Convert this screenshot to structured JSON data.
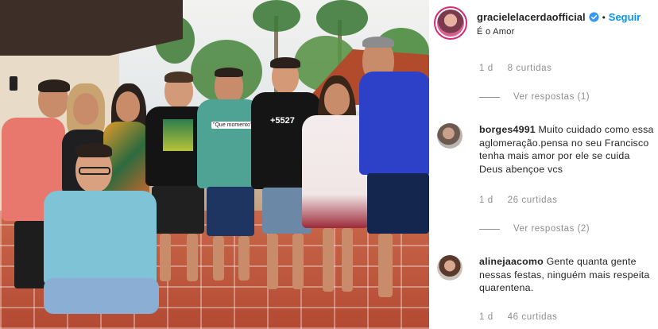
{
  "post": {
    "author": "gracielelacerdaofficial",
    "separator": "•",
    "follow_label": "Seguir",
    "caption": "É o Amor",
    "caption_age": "1 d",
    "caption_likes": "8 curtidas",
    "photo_shirt_texts": [
      "\"Que momento\"",
      "+5527"
    ]
  },
  "comments": [
    {
      "username": "",
      "text": "",
      "age": "",
      "likes": "",
      "replies_label": "Ver respostas (1)"
    },
    {
      "username": "borges4991",
      "text": "Muito cuidado como essa aglomeração.pensa no seu Francisco tenha mais amor por ele se cuida Deus abençoe vcs",
      "age": "1 d",
      "likes": "26 curtidas",
      "replies_label": "Ver respostas (2)"
    },
    {
      "username": "alinejaacomo",
      "text": "Gente quanta gente nessas festas, ninguém mais respeita quarentena.",
      "age": "1 d",
      "likes": "46 curtidas",
      "replies_label": ""
    }
  ],
  "icons": {
    "verified": "verified-badge-icon",
    "replies_line": "thread-line"
  },
  "colors": {
    "follow": "#0095f6",
    "meta": "#8e8e8e",
    "story_ring": "#d62976"
  }
}
